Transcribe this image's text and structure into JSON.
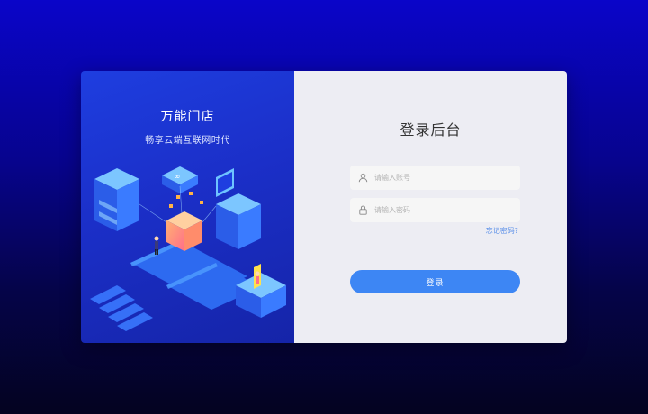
{
  "brand": {
    "title": "万能门店",
    "subtitle": "畅享云端互联网时代"
  },
  "login": {
    "title": "登录后台",
    "account_placeholder": "请输入账号",
    "account_icon": "user-icon",
    "password_placeholder": "请输入密码",
    "password_icon": "lock-icon",
    "forgot_label": "忘记密码?",
    "submit_label": "登录"
  },
  "colors": {
    "background_top": "#0a05c9",
    "background_bottom": "#040320",
    "panel_left": "#1b2fc8",
    "panel_right": "#ededf3",
    "accent": "#3d86f4"
  }
}
